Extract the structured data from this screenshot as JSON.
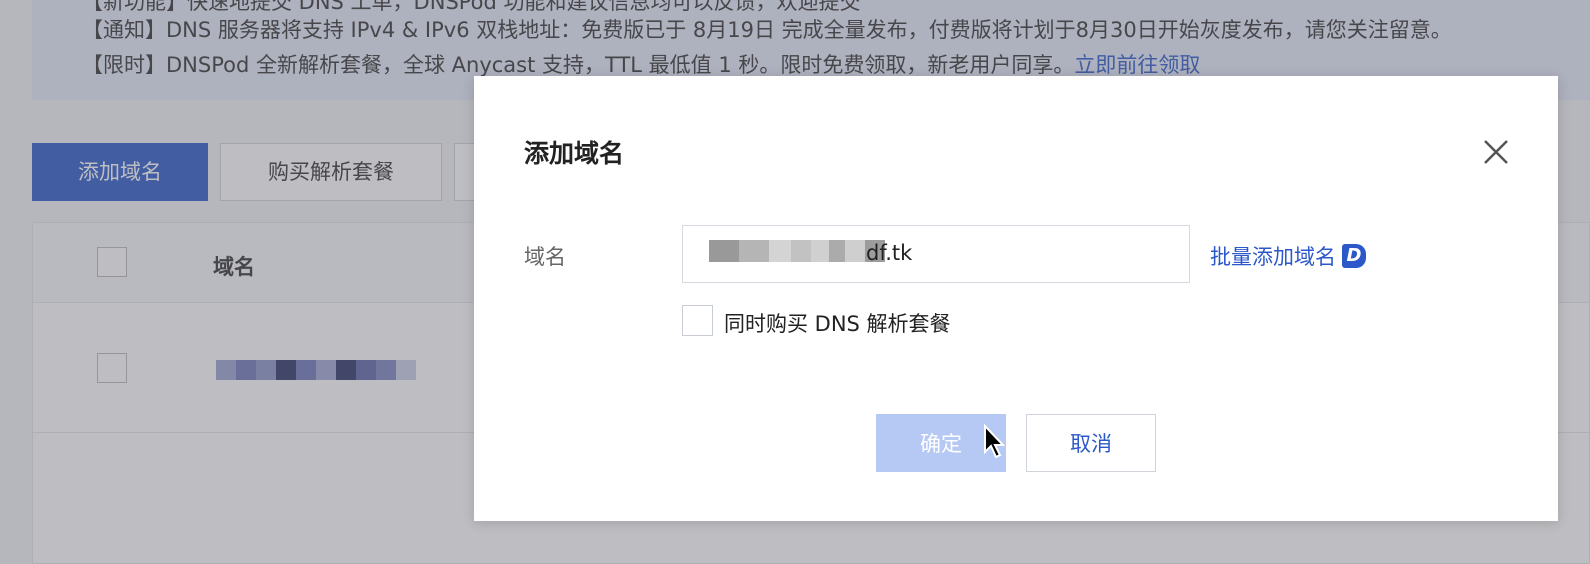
{
  "notices": {
    "line0": "【新功能】快速地提交 DNS 工单，DNSPod 功能和建议信息均可以反馈，欢迎提交",
    "line1": "【通知】DNS 服务器将支持 IPv4 & IPv6 双栈地址：免费版已于 8月19日 完成全量发布，付费版将计划于8月30日开始灰度发布，请您关注留意。",
    "line2_text": "【限时】DNSPod 全新解析套餐，全球 Anycast 支持，TTL 最低值 1 秒。限时免费领取，新老用户同享。",
    "line2_link": "立即前往领取"
  },
  "toolbar": {
    "add_domain": "添加域名",
    "buy_package": "购买解析套餐"
  },
  "table": {
    "header_domain": "域名"
  },
  "modal": {
    "title": "添加域名",
    "domain_label": "域名",
    "domain_value_suffix": "df.tk",
    "bulk_add_link": "批量添加域名",
    "bulk_icon_letter": "D",
    "checkbox_label": "同时购买 DNS 解析套餐",
    "ok_label": "确定",
    "cancel_label": "取消"
  },
  "colors": {
    "primary": "#2c58c9",
    "primary_disabled": "#b6c9f5"
  },
  "icons": [
    "close-icon",
    "d-logo-icon",
    "mouse-pointer-icon"
  ]
}
